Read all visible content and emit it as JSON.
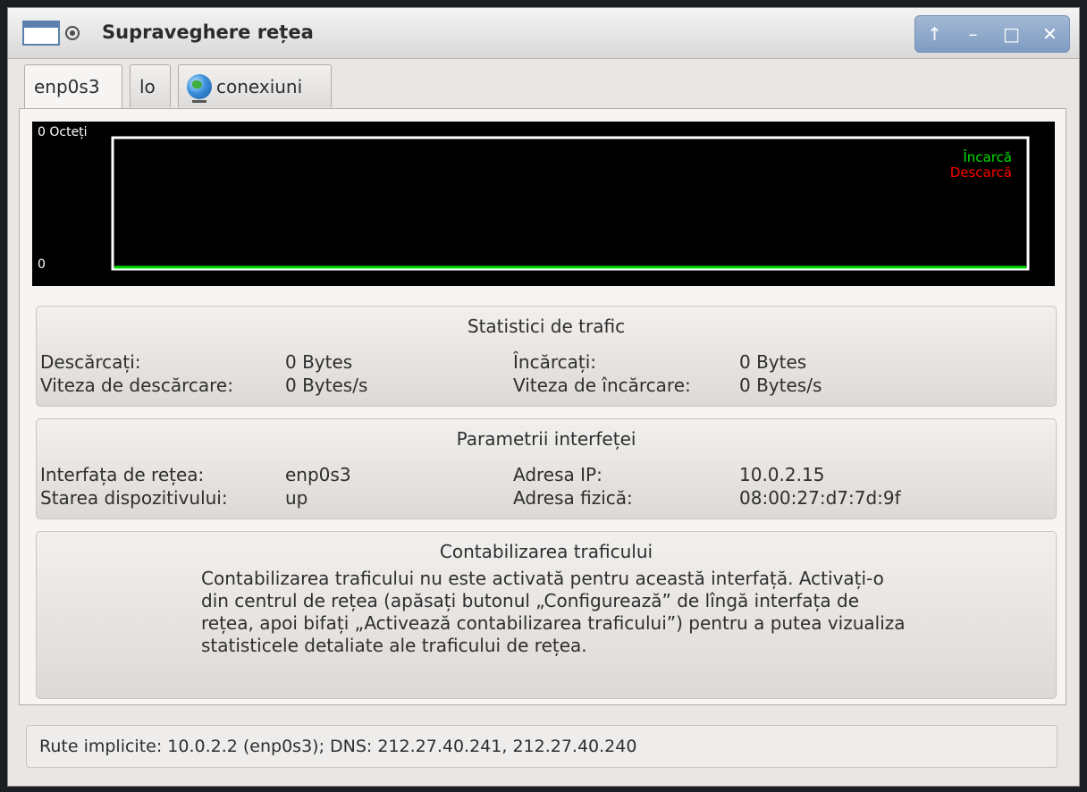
{
  "window": {
    "title": "Supraveghere rețea",
    "controls": {
      "keep_above": "↑",
      "minimize": "–",
      "maximize": "□",
      "close": "✕"
    }
  },
  "tabs": [
    {
      "label": "enp0s3",
      "active": true
    },
    {
      "label": "lo",
      "active": false
    },
    {
      "label": "conexiuni",
      "active": false,
      "icon": "globe-icon"
    }
  ],
  "graph": {
    "y_top_label": "0 Octeți",
    "y_bottom_label": "0",
    "legend": [
      {
        "label": "Încarcă",
        "color": "#00e000"
      },
      {
        "label": "Descarcă",
        "color": "#ff0000"
      }
    ],
    "upload_values": [
      0,
      0
    ],
    "download_values": [
      0,
      0
    ]
  },
  "traffic_stats": {
    "title": "Statistici de trafic",
    "downloaded_label": "Descărcați:",
    "downloaded_value": "0 Bytes",
    "download_speed_label": "Viteza de descărcare:",
    "download_speed_value": "0 Bytes/s",
    "uploaded_label": "Încărcați:",
    "uploaded_value": "0 Bytes",
    "upload_speed_label": "Viteza de încărcare:",
    "upload_speed_value": "0 Bytes/s"
  },
  "interface_params": {
    "title": "Parametrii interfeței",
    "iface_label": "Interfața de rețea:",
    "iface_value": "enp0s3",
    "state_label": "Starea dispozitivului:",
    "state_value": "up",
    "ip_label": "Adresa IP:",
    "ip_value": "10.0.2.15",
    "mac_label": "Adresa fizică:",
    "mac_value": "08:00:27:d7:7d:9f"
  },
  "accounting": {
    "title": "Contabilizarea traficului",
    "message": "Contabilizarea traficului nu este activată pentru această interfață. Activați-o din centrul de rețea (apăsați butonul „Configurează” de lîngă interfața de rețea, apoi bifați „Activează contabilizarea traficului”) pentru a putea vizualiza statisticele detaliate ale traficului de rețea."
  },
  "status_bar": {
    "text": "Rute implicite: 10.0.2.2 (enp0s3); DNS: 212.27.40.241, 212.27.40.240"
  }
}
